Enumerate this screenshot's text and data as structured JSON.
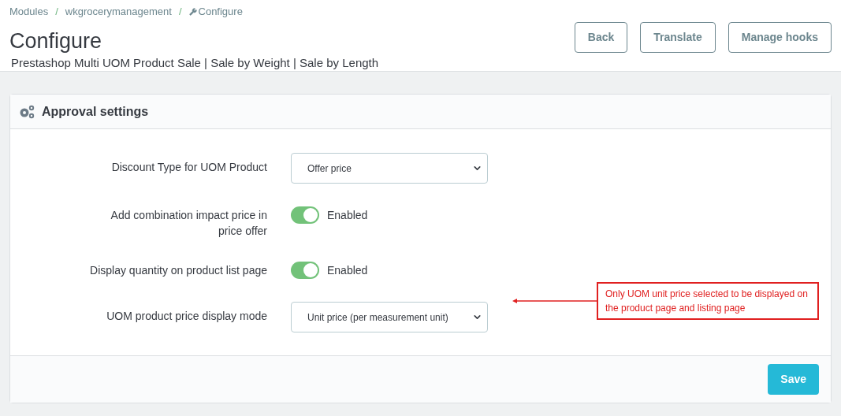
{
  "breadcrumb_separator": "/",
  "breadcrumb": [
    {
      "kind": "link",
      "label": "Modules"
    },
    {
      "kind": "link",
      "label": "wkgrocerymanagement"
    },
    {
      "kind": "current",
      "label": "Configure"
    }
  ],
  "title": "Configure",
  "subtitle": "Prestashop Multi UOM Product Sale | Sale by Weight | Sale by Length",
  "header_buttons": [
    "Back",
    "Translate",
    "Manage hooks"
  ],
  "panel": {
    "title": "Approval settings",
    "fields": [
      {
        "kind": "select",
        "label": "Discount Type for UOM Product",
        "value": "Offer price"
      },
      {
        "kind": "toggle",
        "label": "Add combination impact price in price offer",
        "on": true,
        "state_text": "Enabled"
      },
      {
        "kind": "toggle",
        "label": "Display quantity on product list page",
        "on": true,
        "state_text": "Enabled"
      },
      {
        "kind": "select",
        "label": "UOM product price display mode",
        "value": "Unit price (per measurement unit)"
      }
    ],
    "annotation": "Only UOM unit price selected to be displayed on the product page and listing page",
    "save_button": "Save"
  }
}
